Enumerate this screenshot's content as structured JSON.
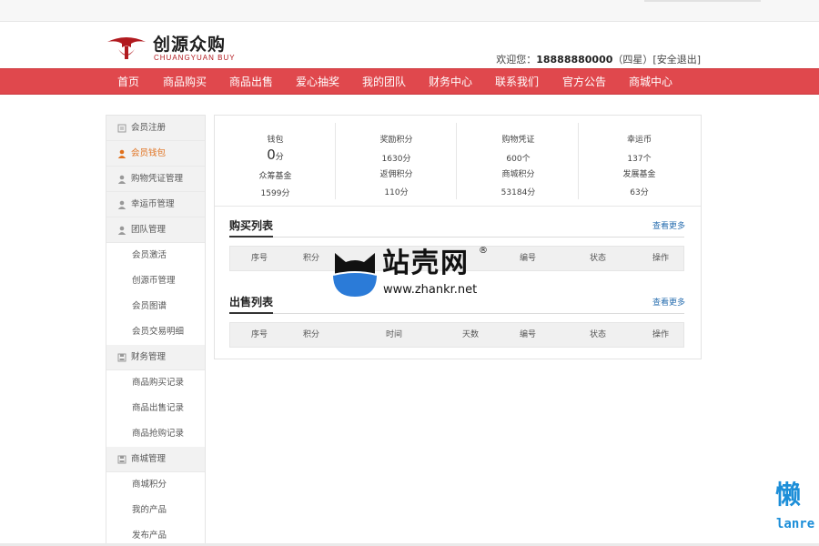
{
  "header": {
    "brand_name": "创源众购",
    "brand_sub": "CHUANGYUAN BUY",
    "welcome": "欢迎您：",
    "phone": "18888880000",
    "level": "（四星）",
    "logout": "[安全退出]"
  },
  "nav": [
    "首页",
    "商品购买",
    "商品出售",
    "爱心抽奖",
    "我的团队",
    "财务中心",
    "联系我们",
    "官方公告",
    "商城中心"
  ],
  "sidebar": {
    "items": [
      {
        "label": "会员注册",
        "icon": "register-icon"
      },
      {
        "label": "会员钱包",
        "icon": "user-icon"
      },
      {
        "label": "购物凭证管理",
        "icon": "user-icon"
      },
      {
        "label": "幸运币管理",
        "icon": "user-icon"
      },
      {
        "label": "团队管理",
        "icon": "user-icon"
      },
      {
        "label": "会员激活"
      },
      {
        "label": "创源币管理"
      },
      {
        "label": "会员图谱"
      },
      {
        "label": "会员交易明细"
      },
      {
        "label": "财务管理",
        "icon": "finance-icon"
      },
      {
        "label": "商品购买记录"
      },
      {
        "label": "商品出售记录"
      },
      {
        "label": "商品抢购记录"
      },
      {
        "label": "商城管理",
        "icon": "finance-icon"
      },
      {
        "label": "商城积分"
      },
      {
        "label": "我的产品"
      },
      {
        "label": "发布产品"
      }
    ]
  },
  "wallet": {
    "cols": [
      {
        "label1": "钱包",
        "value1_num": "0",
        "value1_unit": "分",
        "label2": "众筹基金",
        "value2": "1599分"
      },
      {
        "label1": "奖励积分",
        "value1": "1630分",
        "label2": "返佣积分",
        "value2": "110分"
      },
      {
        "label1": "购物凭证",
        "value1": "600个",
        "label2": "商城积分",
        "value2": "53184分"
      },
      {
        "label1": "幸运币",
        "value1": "137个",
        "label2": "发展基金",
        "value2": "63分"
      }
    ]
  },
  "buy_list": {
    "title": "购买列表",
    "more": "查看更多",
    "columns": [
      "序号",
      "积分",
      "编号",
      "状态",
      "操作"
    ]
  },
  "sell_list": {
    "title": "出售列表",
    "more": "查看更多",
    "columns": [
      "序号",
      "积分",
      "时间",
      "天数",
      "编号",
      "状态",
      "操作"
    ]
  },
  "watermark": {
    "text": "站壳网",
    "reg": "®",
    "url": "www.zhankr.net"
  },
  "corner_logo": {
    "big": "懒",
    "small": "lanre"
  },
  "colors": {
    "nav_bg": "#e0484d",
    "accent_orange": "#e0701c",
    "link_blue": "#2a6fb0",
    "brand_red": "#b11a1f"
  }
}
